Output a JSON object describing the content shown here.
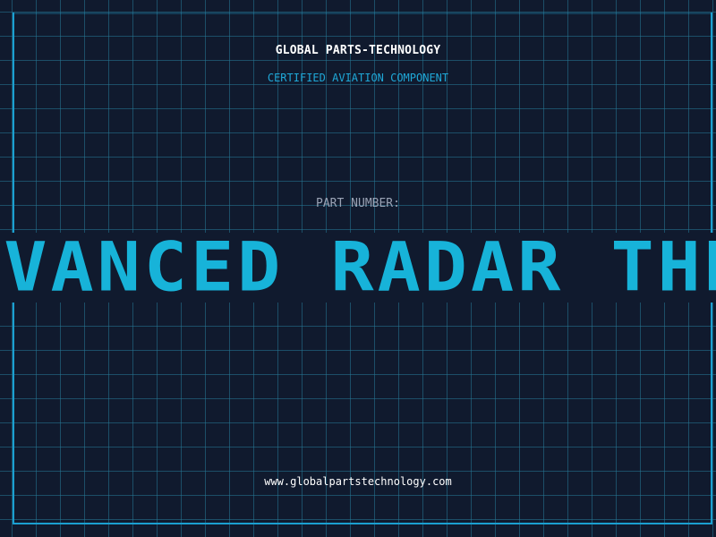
{
  "header": {
    "company": "GLOBAL PARTS-TECHNOLOGY",
    "tagline": "CERTIFIED AVIATION COMPONENT"
  },
  "part": {
    "label": "PART NUMBER:",
    "name": "ADVANCED RADAR THREAT SYSTEM"
  },
  "footer": {
    "url": "www.globalpartstechnology.com"
  },
  "colors": {
    "background": "#101a2e",
    "accent": "#17b3d9",
    "grid": "#267896",
    "label": "#9aa3b5",
    "text": "#ffffff"
  }
}
